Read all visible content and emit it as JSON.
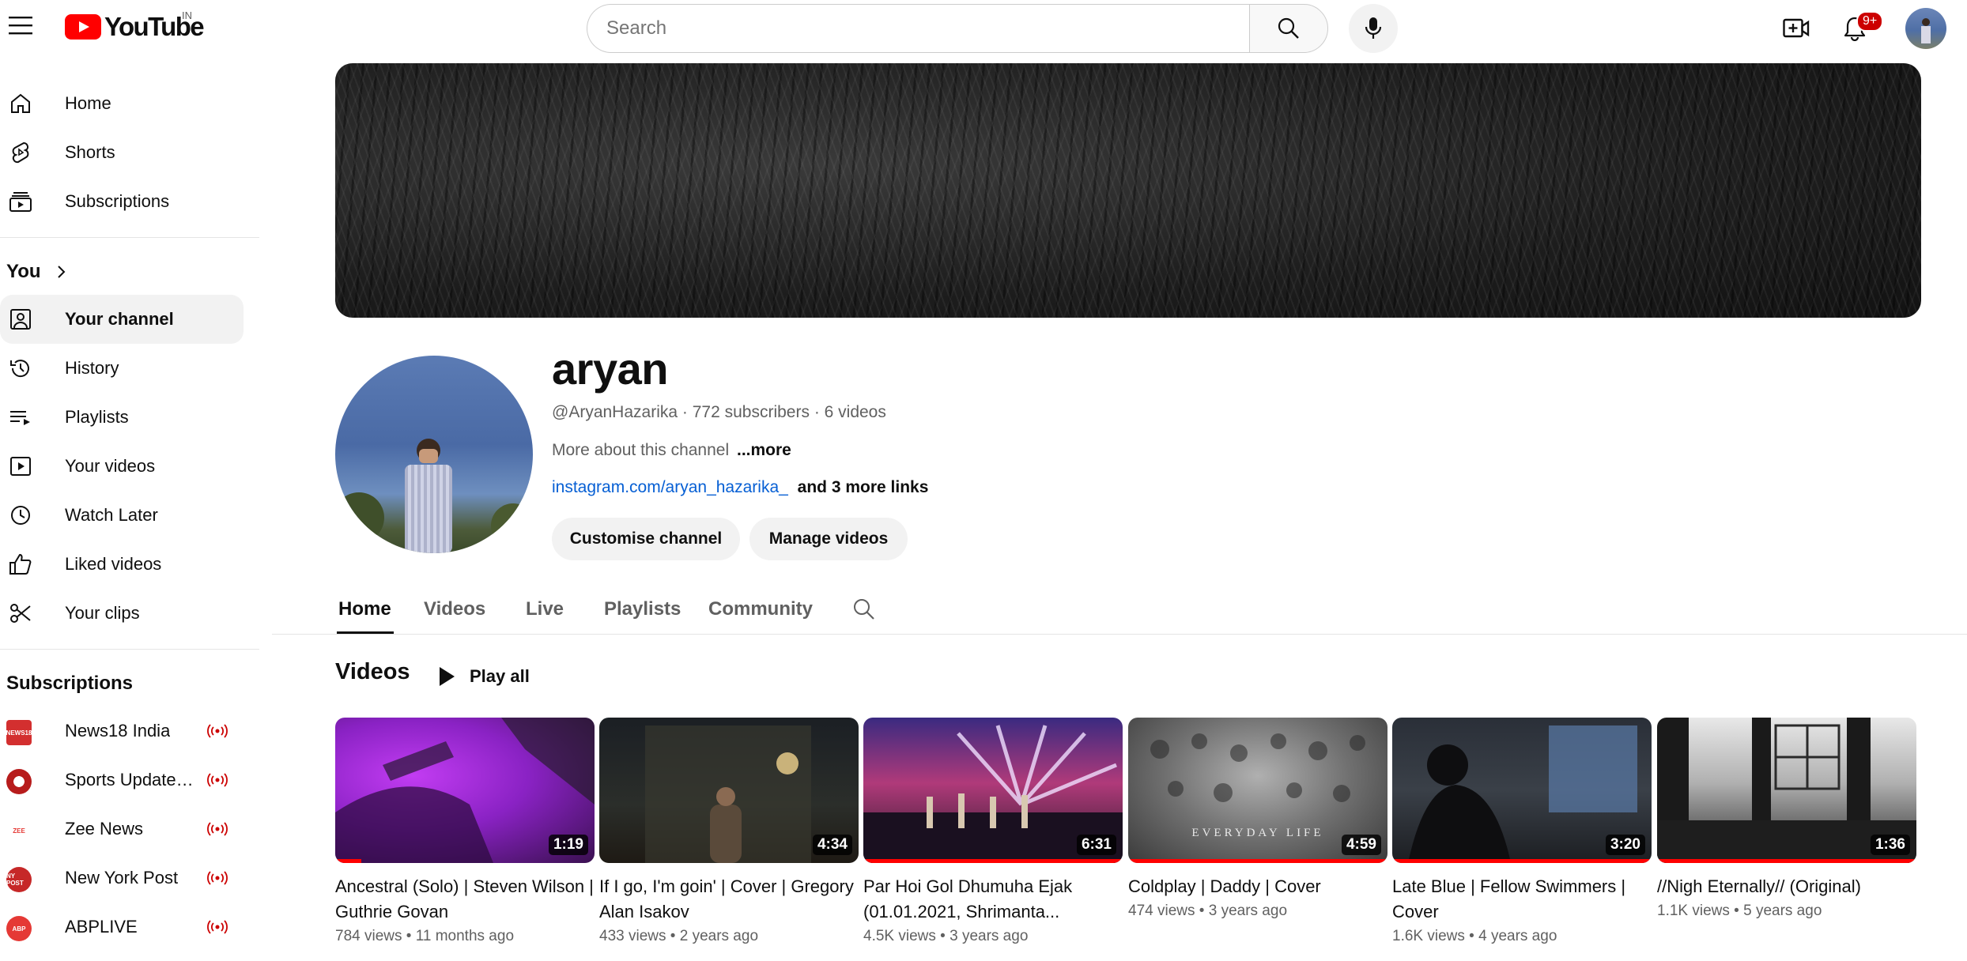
{
  "masthead": {
    "logo_text": "YouTube",
    "country_code": "IN",
    "search_placeholder": "Search",
    "notification_badge": "9+",
    "icons": [
      "menu-icon",
      "search-icon",
      "mic-icon",
      "create-video-icon",
      "bell-icon"
    ]
  },
  "sidebar": {
    "main": [
      {
        "label": "Home",
        "icon": "home-icon"
      },
      {
        "label": "Shorts",
        "icon": "shorts-icon"
      },
      {
        "label": "Subscriptions",
        "icon": "subscriptions-icon"
      }
    ],
    "you_heading": "You",
    "you": [
      {
        "label": "Your channel",
        "icon": "your-channel-icon",
        "active": true
      },
      {
        "label": "History",
        "icon": "history-icon"
      },
      {
        "label": "Playlists",
        "icon": "playlists-icon"
      },
      {
        "label": "Your videos",
        "icon": "your-videos-icon"
      },
      {
        "label": "Watch Later",
        "icon": "watch-later-icon"
      },
      {
        "label": "Liked videos",
        "icon": "liked-videos-icon"
      },
      {
        "label": "Your clips",
        "icon": "clips-icon"
      }
    ],
    "subscriptions_heading": "Subscriptions",
    "subscriptions": [
      {
        "label": "News18 India",
        "avatar_color": "#d32f2f",
        "avatar_text": "NEWS18"
      },
      {
        "label": "Sports Updates ...",
        "avatar_color": "#b71c1c",
        "avatar_text": ""
      },
      {
        "label": "Zee News",
        "avatar_color": "#e53935",
        "avatar_text": "ZEE"
      },
      {
        "label": "New York Post",
        "avatar_color": "#c62828",
        "avatar_text": "NY POST"
      },
      {
        "label": "ABPLIVE",
        "avatar_color": "#e53935",
        "avatar_text": "ABP"
      }
    ]
  },
  "channel": {
    "name": "aryan",
    "handle": "@AryanHazarika",
    "subscribers": "772 subscribers",
    "videos_count": "6 videos",
    "about": "More about this channel",
    "more": "...more",
    "link": "instagram.com/aryan_hazarika_",
    "more_links": "and 3 more links",
    "customise_label": "Customise channel",
    "manage_label": "Manage videos"
  },
  "tabs": [
    {
      "label": "Home",
      "active": true
    },
    {
      "label": "Videos"
    },
    {
      "label": "Live"
    },
    {
      "label": "Playlists"
    },
    {
      "label": "Community"
    }
  ],
  "shelf": {
    "title": "Videos",
    "play_all": "Play all",
    "videos": [
      {
        "title": "Ancestral (Solo) | Steven Wilson | Guthrie Govan",
        "views": "784 views",
        "age": "11 months ago",
        "duration": "1:19",
        "watched": 0.1
      },
      {
        "title": "If I go, I'm goin' | Cover | Gregory Alan Isakov",
        "views": "433 views",
        "age": "2 years ago",
        "duration": "4:34",
        "watched": 0
      },
      {
        "title": "Par Hoi Gol Dhumuha Ejak (01.01.2021, Shrimanta...",
        "views": "4.5K views",
        "age": "3 years ago",
        "duration": "6:31",
        "watched": 1
      },
      {
        "title": "Coldplay | Daddy | Cover",
        "views": "474 views",
        "age": "3 years ago",
        "duration": "4:59",
        "watched": 1
      },
      {
        "title": "Late Blue | Fellow Swimmers | Cover",
        "views": "1.6K views",
        "age": "4 years ago",
        "duration": "3:20",
        "watched": 1
      },
      {
        "title": "//Nigh Eternally// (Original)",
        "views": "1.1K views",
        "age": "5 years ago",
        "duration": "1:36",
        "watched": 1
      }
    ]
  },
  "colors": {
    "brand_red": "#ff0000",
    "link_blue": "#065fd4",
    "text_secondary": "#606060",
    "chip_bg": "#f2f2f2"
  }
}
